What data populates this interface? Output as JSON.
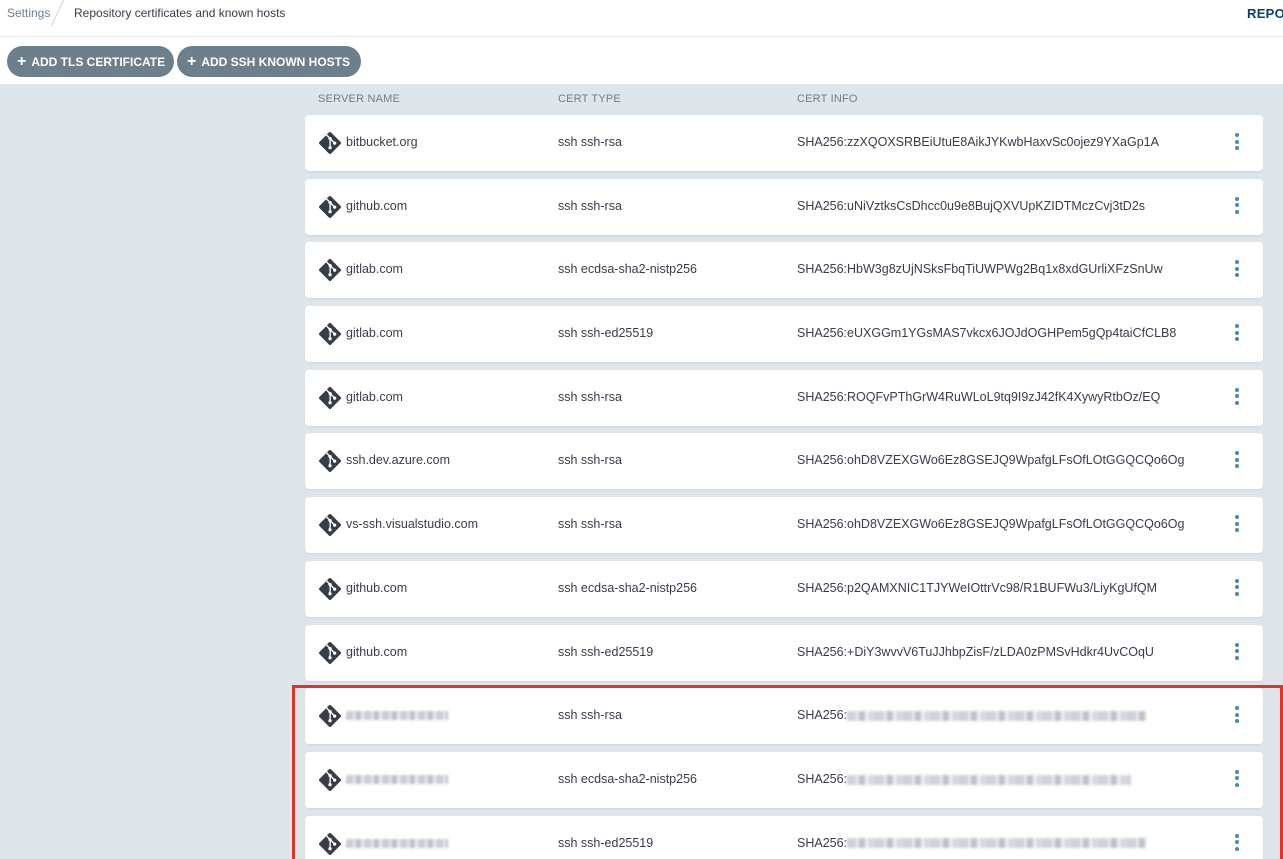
{
  "breadcrumb": {
    "root": "Settings",
    "current": "Repository certificates and known hosts"
  },
  "top_right_link": "REPOS",
  "actions": {
    "add_tls": "ADD TLS CERTIFICATE",
    "add_ssh": "ADD SSH KNOWN HOSTS",
    "plus": "+"
  },
  "columns": {
    "server_name": "SERVER NAME",
    "cert_type": "CERT TYPE",
    "cert_info": "CERT INFO"
  },
  "rows": [
    {
      "server": "bitbucket.org",
      "type": "ssh ssh-rsa",
      "info": "SHA256:zzXQOXSRBEiUtuE8AikJYKwbHaxvSc0ojez9YXaGp1A"
    },
    {
      "server": "github.com",
      "type": "ssh ssh-rsa",
      "info": "SHA256:uNiVztksCsDhcc0u9e8BujQXVUpKZIDTMczCvj3tD2s"
    },
    {
      "server": "gitlab.com",
      "type": "ssh ecdsa-sha2-nistp256",
      "info": "SHA256:HbW3g8zUjNSksFbqTiUWPWg2Bq1x8xdGUrliXFzSnUw"
    },
    {
      "server": "gitlab.com",
      "type": "ssh ssh-ed25519",
      "info": "SHA256:eUXGGm1YGsMAS7vkcx6JOJdOGHPem5gQp4taiCfCLB8"
    },
    {
      "server": "gitlab.com",
      "type": "ssh ssh-rsa",
      "info": "SHA256:ROQFvPThGrW4RuWLoL9tq9I9zJ42fK4XywyRtbOz/EQ"
    },
    {
      "server": "ssh.dev.azure.com",
      "type": "ssh ssh-rsa",
      "info": "SHA256:ohD8VZEXGWo6Ez8GSEJQ9WpafgLFsOfLOtGGQCQo6Og"
    },
    {
      "server": "vs-ssh.visualstudio.com",
      "type": "ssh ssh-rsa",
      "info": "SHA256:ohD8VZEXGWo6Ez8GSEJQ9WpafgLFsOfLOtGGQCQo6Og"
    },
    {
      "server": "github.com",
      "type": "ssh ecdsa-sha2-nistp256",
      "info": "SHA256:p2QAMXNIC1TJYWeIOttrVc98/R1BUFWu3/LiyKgUfQM"
    },
    {
      "server": "github.com",
      "type": "ssh ssh-ed25519",
      "info": "SHA256:+DiY3wvvV6TuJJhbpZisF/zLDA0zPMSvHdkr4UvCOqU"
    },
    {
      "server": "",
      "type": "ssh ssh-rsa",
      "info": "SHA256:"
    },
    {
      "server": "",
      "type": "ssh ecdsa-sha2-nistp256",
      "info": "SHA256:"
    },
    {
      "server": "",
      "type": "ssh ssh-ed25519",
      "info": "SHA256:"
    }
  ],
  "icons": {
    "row_icon": "git-icon",
    "row_menu": "kebab-menu-icon"
  },
  "colors": {
    "button_bg": "#6d7f8b",
    "menu_dots": "#4e8ba8",
    "highlight": "#e0332b",
    "page_bg": "#dee6eb",
    "git_icon": "#363c4a"
  }
}
